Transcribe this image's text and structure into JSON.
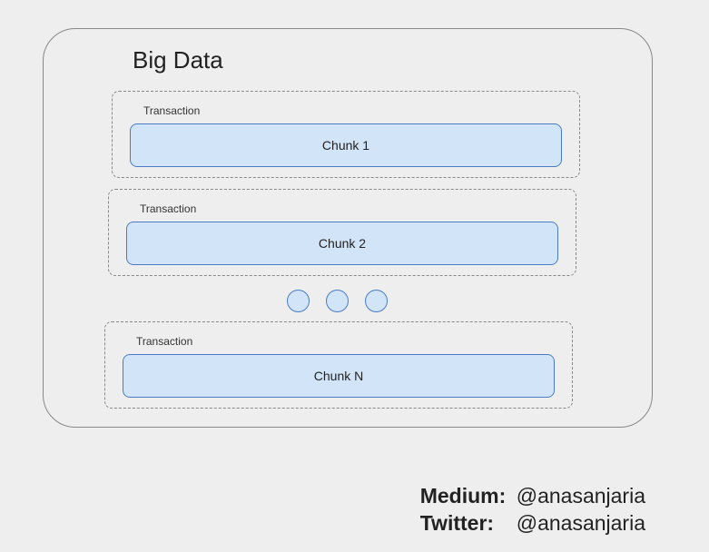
{
  "title": "Big Data",
  "transactions": [
    {
      "label": "Transaction",
      "chunk": "Chunk 1"
    },
    {
      "label": "Transaction",
      "chunk": "Chunk 2"
    },
    {
      "label": "Transaction",
      "chunk": "Chunk N"
    }
  ],
  "credits": {
    "medium": {
      "label": "Medium:",
      "handle": "@anasanjaria"
    },
    "twitter": {
      "label": "Twitter:",
      "handle": "@anasanjaria"
    }
  },
  "colors": {
    "chunk_fill": "#d2e4f8",
    "chunk_border": "#4a7bc4",
    "page_bg": "#eeeeee"
  }
}
